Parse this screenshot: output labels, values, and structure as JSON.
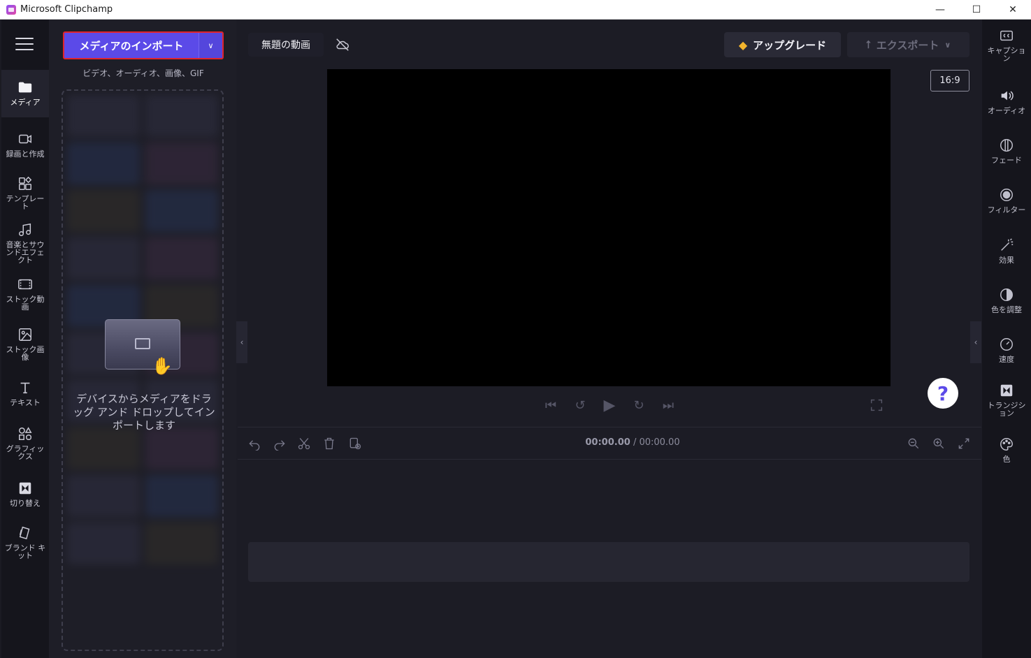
{
  "window": {
    "title": "Microsoft Clipchamp",
    "controls": {
      "minimize": "—",
      "maximize": "☐",
      "close": "✕"
    }
  },
  "left_nav": [
    {
      "id": "media",
      "label": "メディア",
      "icon": "folder-icon"
    },
    {
      "id": "record",
      "label": "録画と作成",
      "icon": "camera-icon"
    },
    {
      "id": "templates",
      "label": "テンプレート",
      "icon": "templates-icon"
    },
    {
      "id": "music",
      "label": "音楽とサウンドエフェクト",
      "icon": "music-icon"
    },
    {
      "id": "stock_video",
      "label": "ストック動画",
      "icon": "stock-video-icon"
    },
    {
      "id": "stock_image",
      "label": "ストック画像",
      "icon": "image-icon"
    },
    {
      "id": "text",
      "label": "テキスト",
      "icon": "text-icon"
    },
    {
      "id": "graphics",
      "label": "グラフィックス",
      "icon": "shapes-icon"
    },
    {
      "id": "transitions",
      "label": "切り替え",
      "icon": "transition-icon"
    },
    {
      "id": "brand",
      "label": "ブランド キット",
      "icon": "brand-kit-icon"
    }
  ],
  "media_panel": {
    "import_label": "メディアのインポート",
    "import_sub": "ビデオ、オーディオ、画像、GIF",
    "drop_text": "デバイスからメディアをドラッグ アンド ドロップしてインポートします"
  },
  "editor": {
    "project_title": "無題の動画",
    "upgrade_label": "アップグレード",
    "export_label": "エクスポート",
    "aspect_ratio": "16:9",
    "help": "?",
    "timecode_current": "00:00.00",
    "timecode_total": "/ 00:00.00"
  },
  "right_nav": [
    {
      "id": "captions",
      "label": "キャプション",
      "icon": "captions-icon"
    },
    {
      "id": "audio",
      "label": "オーディオ",
      "icon": "speaker-icon"
    },
    {
      "id": "fade",
      "label": "フェード",
      "icon": "fade-icon"
    },
    {
      "id": "filters",
      "label": "フィルター",
      "icon": "filter-icon"
    },
    {
      "id": "effects",
      "label": "効果",
      "icon": "magic-wand-icon"
    },
    {
      "id": "color_adjust",
      "label": "色を調整",
      "icon": "contrast-icon"
    },
    {
      "id": "speed",
      "label": "速度",
      "icon": "speedometer-icon"
    },
    {
      "id": "transition",
      "label": "トランジション",
      "icon": "transition-icon"
    },
    {
      "id": "color",
      "label": "色",
      "icon": "palette-icon"
    }
  ]
}
